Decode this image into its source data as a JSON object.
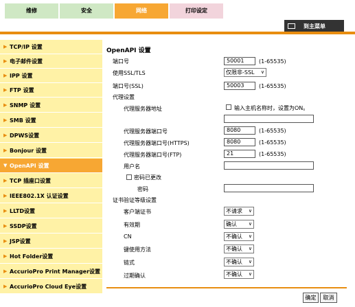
{
  "tabs": [
    "维修",
    "安全",
    "网络",
    "打印设定"
  ],
  "top_button": "到主菜单",
  "sidebar": {
    "items": [
      "TCP/IP 设置",
      "电子邮件设置",
      "IPP 设置",
      "FTP 设置",
      "SNMP 设置",
      "SMB 设置",
      "DPWS设置",
      "Bonjour 设置",
      "OpenAPI 设置",
      "TCP 插座口设置",
      "IEEE802.1X 认证设置",
      "LLTD设置",
      "SSDP设置",
      "JSP设置",
      "Hot Folder设置",
      "AccurioPro Print Manager设置",
      "AccurioPro Cloud Eye设置"
    ]
  },
  "form": {
    "title": "OpenAPI 设置",
    "port_label": "端口号",
    "port_value": "50001",
    "port_range": "(1-65535)",
    "ssl_label": "使用SSL/TLS",
    "ssl_value": "仅限非-SSL",
    "port_ssl_label": "端口号(SSL)",
    "port_ssl_value": "50003",
    "port_ssl_range": "(1-65535)",
    "proxy_section": "代理设置",
    "proxy_addr_label": "代理服务器地址",
    "proxy_hostname_checkbox": "输入主机名称时，设置为ON。",
    "proxy_addr_value": "",
    "proxy_port_label": "代理服务器端口号",
    "proxy_port_value": "8080",
    "proxy_port_range": "(1-65535)",
    "proxy_https_label": "代理服务器端口号(HTTPS)",
    "proxy_https_value": "8080",
    "proxy_https_range": "(1-65535)",
    "proxy_ftp_label": "代理服务器端口号(FTP)",
    "proxy_ftp_value": "21",
    "proxy_ftp_range": "(1-65535)",
    "username_label": "用户名",
    "username_value": "",
    "password_changed_label": "密码已更改",
    "password_label": "密码",
    "password_value": "",
    "cert_section": "证书验证等级设置",
    "client_cert_label": "客户端证书",
    "client_cert_value": "不请求",
    "validity_label": "有效期",
    "validity_value": "确认",
    "cn_label": "CN",
    "cn_value": "不确认",
    "key_usage_label": "键使用方法",
    "key_usage_value": "不确认",
    "chain_label": "链式",
    "chain_value": "不确认",
    "expiry_label": "过期确认",
    "expiry_value": "不确认"
  },
  "buttons": {
    "ok": "确定",
    "cancel": "取消"
  },
  "colors": {
    "accent": "#f7a733",
    "sidebar_bg": "#fff2a6",
    "line": "#e88d10"
  }
}
